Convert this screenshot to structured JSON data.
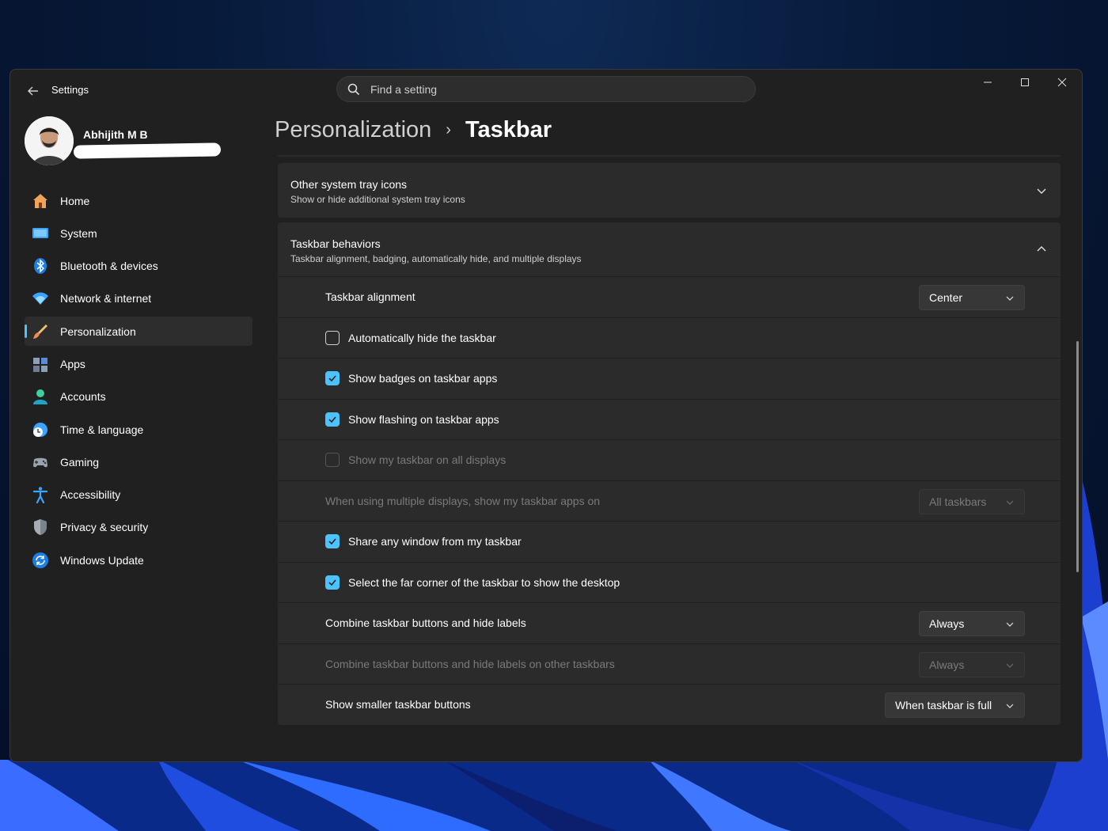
{
  "window": {
    "app_title": "Settings",
    "search_placeholder": "Find a setting"
  },
  "user": {
    "name": "Abhijith M B"
  },
  "sidebar": {
    "items": [
      {
        "label": "Home",
        "icon": "home-icon"
      },
      {
        "label": "System",
        "icon": "monitor-icon"
      },
      {
        "label": "Bluetooth & devices",
        "icon": "bluetooth-icon"
      },
      {
        "label": "Network & internet",
        "icon": "wifi-icon"
      },
      {
        "label": "Personalization",
        "icon": "paintbrush-icon",
        "active": true
      },
      {
        "label": "Apps",
        "icon": "apps-icon"
      },
      {
        "label": "Accounts",
        "icon": "person-icon"
      },
      {
        "label": "Time & language",
        "icon": "clock-globe-icon"
      },
      {
        "label": "Gaming",
        "icon": "gamepad-icon"
      },
      {
        "label": "Accessibility",
        "icon": "accessibility-icon"
      },
      {
        "label": "Privacy & security",
        "icon": "shield-icon"
      },
      {
        "label": "Windows Update",
        "icon": "refresh-icon"
      }
    ]
  },
  "breadcrumb": {
    "parent": "Personalization",
    "current": "Taskbar"
  },
  "sections": {
    "tray": {
      "title": "Other system tray icons",
      "subtitle": "Show or hide additional system tray icons"
    },
    "behaviors": {
      "title": "Taskbar behaviors",
      "subtitle": "Taskbar alignment, badging, automatically hide, and multiple displays"
    }
  },
  "settings": {
    "alignment": {
      "label": "Taskbar alignment",
      "value": "Center"
    },
    "auto_hide": {
      "label": "Automatically hide the taskbar",
      "checked": false
    },
    "badges": {
      "label": "Show badges on taskbar apps",
      "checked": true
    },
    "flashing": {
      "label": "Show flashing on taskbar apps",
      "checked": true
    },
    "all_displays": {
      "label": "Show my taskbar on all displays",
      "checked": false,
      "disabled": true
    },
    "multi_display": {
      "label": "When using multiple displays, show my taskbar apps on",
      "value": "All taskbars",
      "disabled": true
    },
    "share_window": {
      "label": "Share any window from my taskbar",
      "checked": true
    },
    "far_corner": {
      "label": "Select the far corner of the taskbar to show the desktop",
      "checked": true
    },
    "combine": {
      "label": "Combine taskbar buttons and hide labels",
      "value": "Always"
    },
    "combine_other": {
      "label": "Combine taskbar buttons and hide labels on other taskbars",
      "value": "Always",
      "disabled": true
    },
    "smaller_buttons": {
      "label": "Show smaller taskbar buttons",
      "value": "When taskbar is full"
    }
  },
  "colors": {
    "accent": "#4cc2ff",
    "window_bg": "#202020",
    "card_bg": "#2b2b2b"
  }
}
